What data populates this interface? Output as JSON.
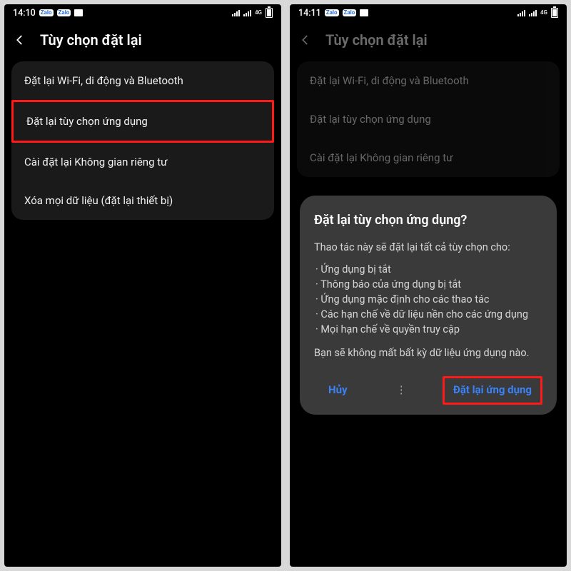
{
  "left": {
    "statusbar": {
      "time": "14:10",
      "net": "4G"
    },
    "header": {
      "title": "Tùy chọn đặt lại"
    },
    "rows": [
      "Đặt lại Wi-Fi, di động và Bluetooth",
      "Đặt lại tùy chọn ứng dụng",
      "Cài đặt lại Không gian riêng tư",
      "Xóa mọi dữ liệu (đặt lại thiết bị)"
    ]
  },
  "right": {
    "statusbar": {
      "time": "14:11",
      "net": "4G"
    },
    "header": {
      "title": "Tùy chọn đặt lại"
    },
    "rows": [
      "Đặt lại Wi-Fi, di động và Bluetooth",
      "Đặt lại tùy chọn ứng dụng",
      "Cài đặt lại Không gian riêng tư"
    ],
    "dialog": {
      "title": "Đặt lại tùy chọn ứng dụng?",
      "intro": "Thao tác này sẽ đặt lại tất cả tùy chọn cho:",
      "bullets": [
        "Ứng dụng bị tắt",
        "Thông báo của ứng dụng bị tắt",
        "Ứng dụng mặc định cho các thao tác",
        "Các hạn chế về dữ liệu nền cho các ứng dụng",
        "Mọi hạn chế về quyền truy cập"
      ],
      "note": "Bạn sẽ không mất bất kỳ dữ liệu ứng dụng nào.",
      "cancel": "Hủy",
      "confirm": "Đặt lại ứng dụng"
    }
  },
  "badges": {
    "zalo": "Zalo"
  }
}
